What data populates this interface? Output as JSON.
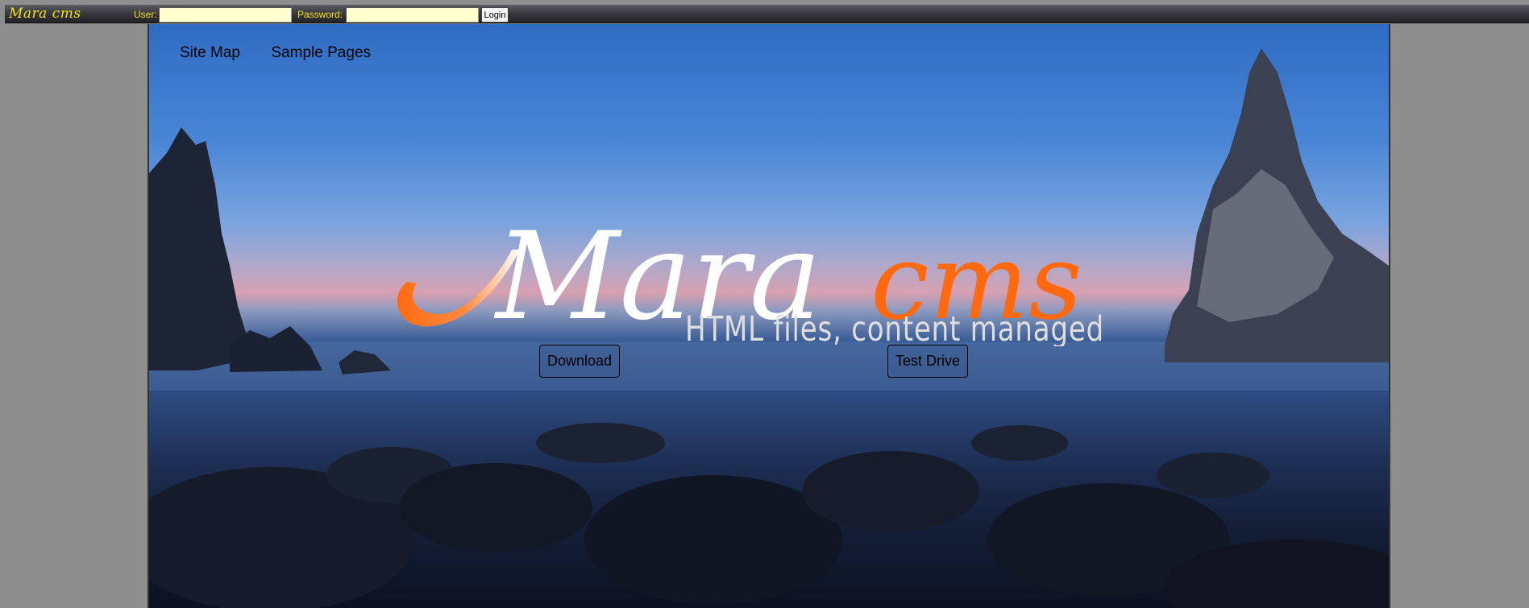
{
  "topbar": {
    "brand": "Mara cms",
    "user_label": "User:",
    "user_value": "",
    "password_label": "Password:",
    "password_value": "",
    "login_label": "Login",
    "brand_color": "#f0e020",
    "input_bg": "#ffffd0"
  },
  "nav": {
    "items": [
      {
        "label": "Site Map"
      },
      {
        "label": "Sample Pages"
      }
    ]
  },
  "hero": {
    "logo_word1": "Mara",
    "logo_word2": "cms",
    "tagline": "HTML files, content managed",
    "accent_color": "#ff6a10",
    "download_label": "Download",
    "testdrive_label": "Test Drive"
  }
}
